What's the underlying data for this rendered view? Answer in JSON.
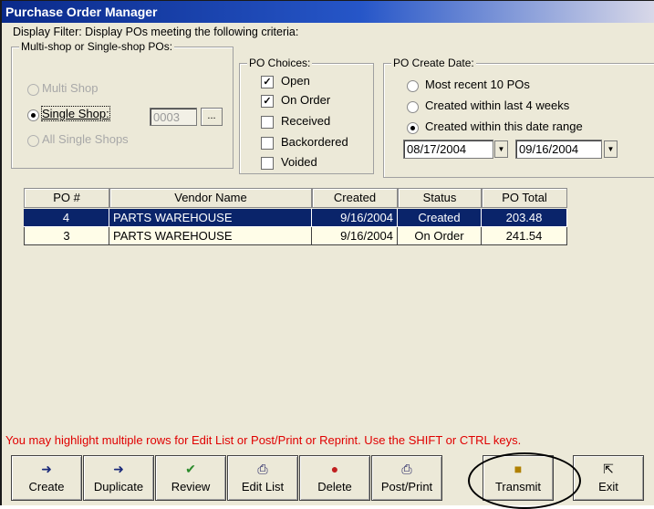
{
  "window": {
    "title": "Purchase Order Manager"
  },
  "filter": {
    "caption": "Display Filter: Display POs meeting the following criteria:"
  },
  "shop_group": {
    "legend": "Multi-shop or Single-shop POs:",
    "options": [
      "Multi Shop",
      "Single Shop:",
      "All Single Shops"
    ],
    "selected": "Single Shop:",
    "shop_code": "0003",
    "browse_label": "..."
  },
  "choices_group": {
    "legend": "PO Choices:",
    "items": [
      {
        "label": "Open",
        "checked": true
      },
      {
        "label": "On Order",
        "checked": true
      },
      {
        "label": "Received",
        "checked": false
      },
      {
        "label": "Backordered",
        "checked": false
      },
      {
        "label": "Voided",
        "checked": false
      }
    ]
  },
  "date_group": {
    "legend": "PO Create Date:",
    "options": [
      "Most recent 10 POs",
      "Created within last 4 weeks",
      "Created within this date range"
    ],
    "selected": "Created within this date range",
    "from_date": "08/17/2004",
    "to_date": "09/16/2004"
  },
  "table": {
    "columns": [
      "PO #",
      "Vendor Name",
      "Created",
      "Status",
      "PO Total"
    ],
    "rows": [
      {
        "po": "4",
        "vendor": "PARTS WAREHOUSE",
        "created": "9/16/2004",
        "status": "Created",
        "total": "203.48",
        "selected": true
      },
      {
        "po": "3",
        "vendor": "PARTS WAREHOUSE",
        "created": "9/16/2004",
        "status": "On Order",
        "total": "241.54",
        "selected": false
      }
    ]
  },
  "hint": "You may highlight multiple rows for Edit List or Post/Print or Reprint. Use the SHIFT or CTRL keys.",
  "buttons": [
    {
      "label": "Create",
      "icon": "create-icon"
    },
    {
      "label": "Duplicate",
      "icon": "duplicate-icon"
    },
    {
      "label": "Review",
      "icon": "checkmark-icon"
    },
    {
      "label": "Edit List",
      "icon": "printer-icon"
    },
    {
      "label": "Delete",
      "icon": "delete-icon"
    },
    {
      "label": "Post/Print",
      "icon": "printer-icon"
    },
    {
      "label": "Transmit",
      "icon": "transmit-icon"
    },
    {
      "label": "Exit",
      "icon": "exit-icon"
    }
  ],
  "colors": {
    "title_bar": "#0a246a",
    "selected_row": "#0a246a",
    "hint_text": "#e00000",
    "window_bg": "#ece9d8"
  }
}
